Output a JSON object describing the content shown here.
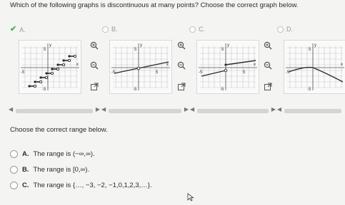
{
  "question": "Which of the following graphs is discontinuous at many points? Choose the correct graph below.",
  "graph_options": [
    {
      "letter": "A.",
      "selected": true,
      "correct_mark": "checkmark-icon"
    },
    {
      "letter": "B.",
      "selected": false
    },
    {
      "letter": "C.",
      "selected": false
    },
    {
      "letter": "D.",
      "selected": false
    }
  ],
  "axis_labels": {
    "x": "x",
    "y": "y",
    "five": "5",
    "neg_five": "-5"
  },
  "tools": [
    "zoom-in-icon",
    "zoom-out-icon",
    "expand-icon"
  ],
  "range_prompt": "Choose the correct range below.",
  "range_options": [
    {
      "letter": "A.",
      "text": "The range is (−∞,∞)."
    },
    {
      "letter": "B.",
      "text": "The range is [0,∞)."
    },
    {
      "letter": "C.",
      "text": "The range is {…, −3, −2, −1,0,1,2,3,…}."
    }
  ],
  "colors": {
    "accent_check": "#4caf50",
    "curve": "#2b2b2b",
    "grid": "#c8c8c8"
  }
}
